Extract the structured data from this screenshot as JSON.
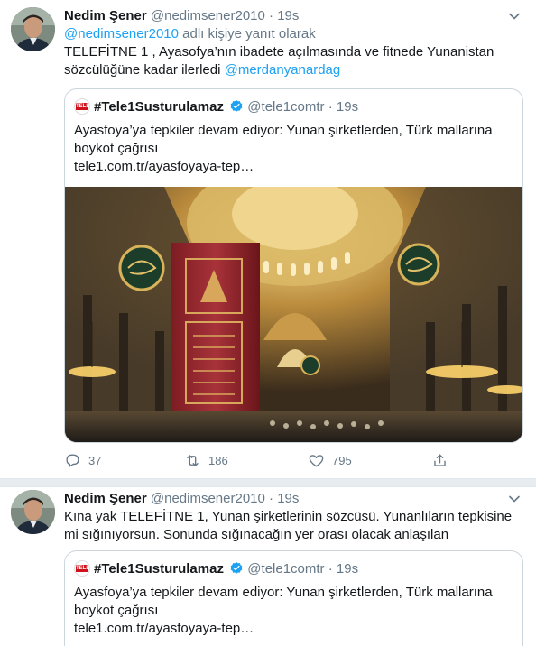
{
  "tweets": [
    {
      "author_name": "Nedim Şener",
      "author_handle": "@nedimsener2010",
      "separator": "·",
      "time": "19s",
      "reply_to_handle": "@nedimsener2010",
      "reply_suffix": " adlı kişiye yanıt olarak",
      "text_line1": "TELEFİTNE 1 , Ayasofya’nın ibadete açılmasında ve fitnede Yunanistan",
      "text_line2": "sözcülüğüne kadar ilerledi ",
      "mention": "@merdanyanardag",
      "quote": {
        "logo_text": "TELE1",
        "name": "#Tele1Susturulamaz",
        "handle": "@tele1comtr",
        "separator": "·",
        "time": "19s",
        "text_line1": "Ayasfoya’ya tepkiler devam ediyor: Yunan şirketlerden, Türk mallarına",
        "text_line2": "boykot çağrısı",
        "link": "tele1.com.tr/ayasfoyaya-tep…"
      },
      "actions": {
        "replies": "37",
        "retweets": "186",
        "likes": "795"
      }
    },
    {
      "author_name": "Nedim Şener",
      "author_handle": "@nedimsener2010",
      "separator": "·",
      "time": "19s",
      "text_line1": "Kına yak TELEFİTNE 1, Yunan şirketlerinin sözcüsü. Yunanlıların tepkisine",
      "text_line2": "mi sığınıyorsun. Sonunda sığınacağın yer orası olacak anlaşılan",
      "quote": {
        "logo_text": "TELE1",
        "name": "#Tele1Susturulamaz",
        "handle": "@tele1comtr",
        "separator": "·",
        "time": "19s",
        "text_line1": "Ayasfoya’ya tepkiler devam ediyor: Yunan şirketlerden, Türk mallarına",
        "text_line2": "boykot çağrısı",
        "link": "tele1.com.tr/ayasfoyaya-tep…"
      }
    }
  ],
  "colors": {
    "link_blue": "#1da1f2",
    "muted_gray": "#657786",
    "separator_bg": "#e6ecf0",
    "verified_blue": "#1da1f2"
  },
  "icons": [
    "chevron-down-icon",
    "verified-badge-icon",
    "reply-icon",
    "retweet-icon",
    "like-icon",
    "share-icon"
  ]
}
